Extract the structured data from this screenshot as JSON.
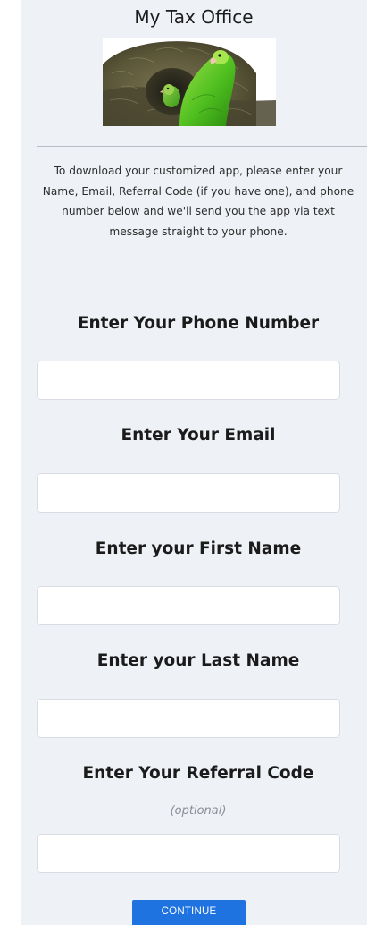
{
  "header": {
    "title": "My Tax Office"
  },
  "intro": {
    "text": "To download your customized app, please enter your Name, Email, Referral Code (if you have one), and phone number below and we'll send you the app via text message straight to your phone."
  },
  "form": {
    "phone_label": "Enter Your Phone Number",
    "email_label": "Enter Your Email",
    "first_name_label": "Enter your First Name",
    "last_name_label": "Enter your Last Name",
    "referral_label": "Enter Your Referral Code",
    "referral_note": "(optional)",
    "phone_value": "",
    "email_value": "",
    "first_name_value": "",
    "last_name_value": "",
    "referral_value": ""
  },
  "actions": {
    "continue_label": "CONTINUE",
    "continue_color": "#1f73e0"
  }
}
